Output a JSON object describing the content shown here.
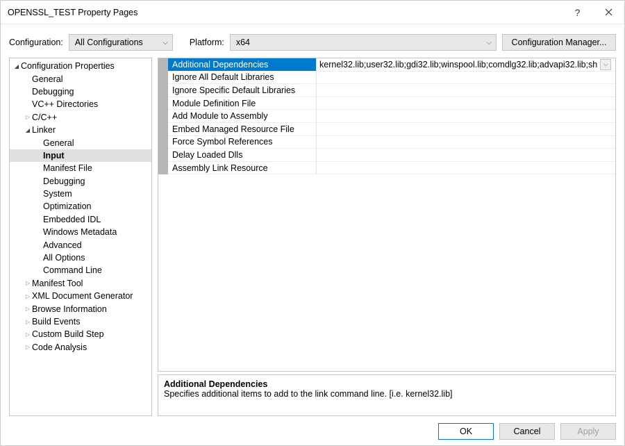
{
  "window": {
    "title": "OPENSSL_TEST Property Pages"
  },
  "toolbar": {
    "configuration_label": "Configuration:",
    "configuration_value": "All Configurations",
    "platform_label": "Platform:",
    "platform_value": "x64",
    "config_manager_label": "Configuration Manager..."
  },
  "tree": [
    {
      "label": "Configuration Properties",
      "depth": 0,
      "expander": "▾"
    },
    {
      "label": "General",
      "depth": 1,
      "expander": ""
    },
    {
      "label": "Debugging",
      "depth": 1,
      "expander": ""
    },
    {
      "label": "VC++ Directories",
      "depth": 1,
      "expander": ""
    },
    {
      "label": "C/C++",
      "depth": 1,
      "expander": "▹"
    },
    {
      "label": "Linker",
      "depth": 1,
      "expander": "▾"
    },
    {
      "label": "General",
      "depth": 2,
      "expander": ""
    },
    {
      "label": "Input",
      "depth": 2,
      "expander": "",
      "selected": true
    },
    {
      "label": "Manifest File",
      "depth": 2,
      "expander": ""
    },
    {
      "label": "Debugging",
      "depth": 2,
      "expander": ""
    },
    {
      "label": "System",
      "depth": 2,
      "expander": ""
    },
    {
      "label": "Optimization",
      "depth": 2,
      "expander": ""
    },
    {
      "label": "Embedded IDL",
      "depth": 2,
      "expander": ""
    },
    {
      "label": "Windows Metadata",
      "depth": 2,
      "expander": ""
    },
    {
      "label": "Advanced",
      "depth": 2,
      "expander": ""
    },
    {
      "label": "All Options",
      "depth": 2,
      "expander": ""
    },
    {
      "label": "Command Line",
      "depth": 2,
      "expander": ""
    },
    {
      "label": "Manifest Tool",
      "depth": 1,
      "expander": "▹"
    },
    {
      "label": "XML Document Generator",
      "depth": 1,
      "expander": "▹"
    },
    {
      "label": "Browse Information",
      "depth": 1,
      "expander": "▹"
    },
    {
      "label": "Build Events",
      "depth": 1,
      "expander": "▹"
    },
    {
      "label": "Custom Build Step",
      "depth": 1,
      "expander": "▹"
    },
    {
      "label": "Code Analysis",
      "depth": 1,
      "expander": "▹"
    }
  ],
  "properties": [
    {
      "name": "Additional Dependencies",
      "value": "kernel32.lib;user32.lib;gdi32.lib;winspool.lib;comdlg32.lib;advapi32.lib;sh",
      "selected": true
    },
    {
      "name": "Ignore All Default Libraries",
      "value": ""
    },
    {
      "name": "Ignore Specific Default Libraries",
      "value": ""
    },
    {
      "name": "Module Definition File",
      "value": ""
    },
    {
      "name": "Add Module to Assembly",
      "value": ""
    },
    {
      "name": "Embed Managed Resource File",
      "value": ""
    },
    {
      "name": "Force Symbol References",
      "value": ""
    },
    {
      "name": "Delay Loaded Dlls",
      "value": ""
    },
    {
      "name": "Assembly Link Resource",
      "value": ""
    }
  ],
  "description": {
    "title": "Additional Dependencies",
    "text": "Specifies additional items to add to the link command line. [i.e. kernel32.lib]"
  },
  "buttons": {
    "ok": "OK",
    "cancel": "Cancel",
    "apply": "Apply"
  }
}
